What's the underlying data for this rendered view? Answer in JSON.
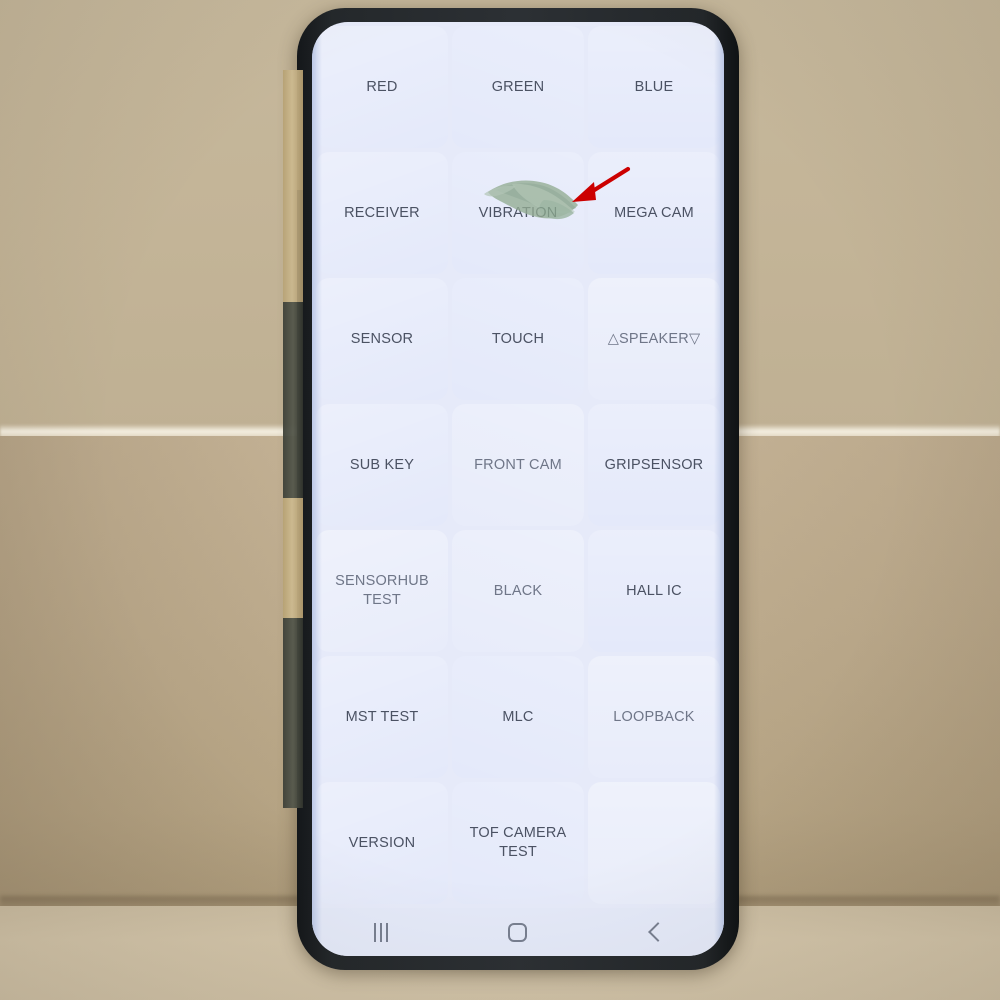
{
  "scene": {
    "description": "Smartphone held on a desk displaying an engineering hardware self-test grid menu",
    "background": {
      "wall_color": "#c3b497",
      "box_color": "#bdab8d",
      "table_color": "#d0c2a7"
    },
    "annotation": {
      "arrow_color": "#cc0000",
      "arrow_name": "red-pointer-arrow",
      "target": "VIBRATION",
      "smudge_color": "#8faa92",
      "smudge_name": "green-screen-defect-smudge"
    }
  },
  "phone": {
    "frame_color": "#2c3034",
    "screen_background": "#e4e9fa",
    "tape_color": "#c3ae82",
    "camera": {
      "name": "punch-hole-front-camera",
      "ring_color": "#0a0b0d",
      "lens_color": "#c2b48f"
    }
  },
  "screen": {
    "grid": {
      "columns": 3,
      "rows": 7,
      "cells": [
        {
          "label": "RED",
          "style": "normal"
        },
        {
          "label": "GREEN",
          "style": "normal"
        },
        {
          "label": "BLUE",
          "style": "normal"
        },
        {
          "label": "RECEIVER",
          "style": "normal"
        },
        {
          "label": "VIBRATION",
          "style": "normal"
        },
        {
          "label": "MEGA CAM",
          "style": "normal"
        },
        {
          "label": "SENSOR",
          "style": "normal"
        },
        {
          "label": "TOUCH",
          "style": "normal"
        },
        {
          "label": "△SPEAKER▽",
          "style": "dim"
        },
        {
          "label": "SUB KEY",
          "style": "normal"
        },
        {
          "label": "FRONT CAM",
          "style": "dim"
        },
        {
          "label": "GRIPSENSOR",
          "style": "normal"
        },
        {
          "label": "SENSORHUB TEST",
          "style": "dim"
        },
        {
          "label": "BLACK",
          "style": "dim"
        },
        {
          "label": "HALL IC",
          "style": "normal"
        },
        {
          "label": "MST TEST",
          "style": "normal"
        },
        {
          "label": "MLC",
          "style": "normal"
        },
        {
          "label": "LOOPBACK",
          "style": "dim"
        },
        {
          "label": "VERSION",
          "style": "normal"
        },
        {
          "label": "TOF CAMERA TEST",
          "style": "normal"
        },
        {
          "label": "",
          "style": "empty"
        }
      ]
    },
    "navbar": {
      "recents_label": "recents",
      "home_label": "home",
      "back_label": "back"
    }
  }
}
